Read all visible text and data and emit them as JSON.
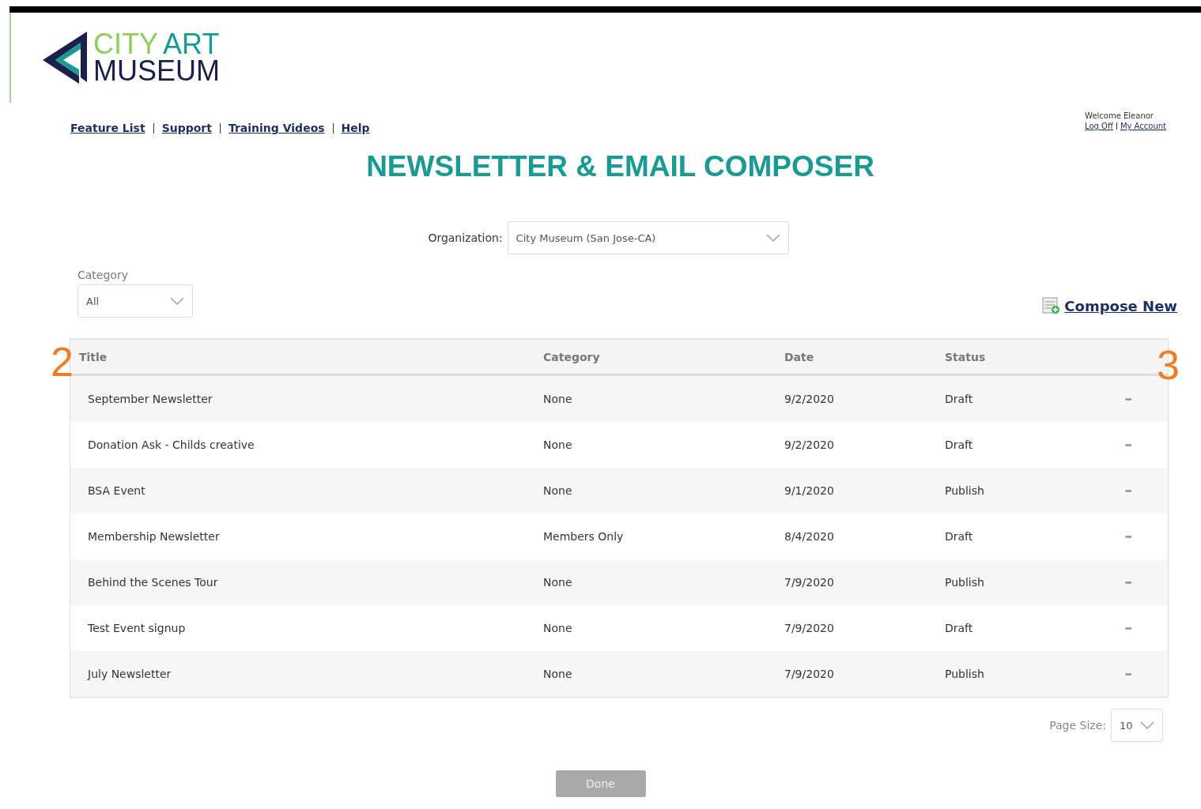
{
  "logo": {
    "line_1a": "CITY",
    "line_1b": "ART",
    "line_2": "MUSEUM"
  },
  "nav_links": [
    "Feature List",
    "Support",
    "Training Videos",
    "Help"
  ],
  "user": {
    "welcome": "Welcome Eleanor",
    "links": [
      "Log Off",
      "My Account"
    ]
  },
  "title": "NEWSLETTER & EMAIL COMPOSER",
  "organization": {
    "label": "Organization:",
    "value": "City Museum (San Jose-CA)"
  },
  "category_filter": {
    "label": "Category",
    "value": "All"
  },
  "compose_new": "Compose New",
  "annotations": [
    "2",
    "3"
  ],
  "table": {
    "columns": [
      "Title",
      "Category",
      "Date",
      "Status"
    ],
    "rows": [
      {
        "title": "September Newsletter",
        "category": "None",
        "date": "9/2/2020",
        "status": "Draft",
        "menu": "•••"
      },
      {
        "title": "Donation Ask - Childs creative",
        "category": "None",
        "date": "9/2/2020",
        "status": "Draft",
        "menu": "•••"
      },
      {
        "title": "BSA Event",
        "category": "None",
        "date": "9/1/2020",
        "status": "Publish",
        "menu": "•••"
      },
      {
        "title": "Membership Newsletter",
        "category": "Members Only",
        "date": "8/4/2020",
        "status": "Draft",
        "menu": "•••"
      },
      {
        "title": "Behind the Scenes Tour",
        "category": "None",
        "date": "7/9/2020",
        "status": "Publish",
        "menu": "•••"
      },
      {
        "title": "Test Event signup",
        "category": "None",
        "date": "7/9/2020",
        "status": "Draft",
        "menu": "•••"
      },
      {
        "title": "July Newsletter",
        "category": "None",
        "date": "7/9/2020",
        "status": "Publish",
        "menu": "•••"
      }
    ]
  },
  "page_size": {
    "label": "Page Size:",
    "value": "10"
  },
  "done_button": {
    "label": "Done",
    "disabled": true
  }
}
